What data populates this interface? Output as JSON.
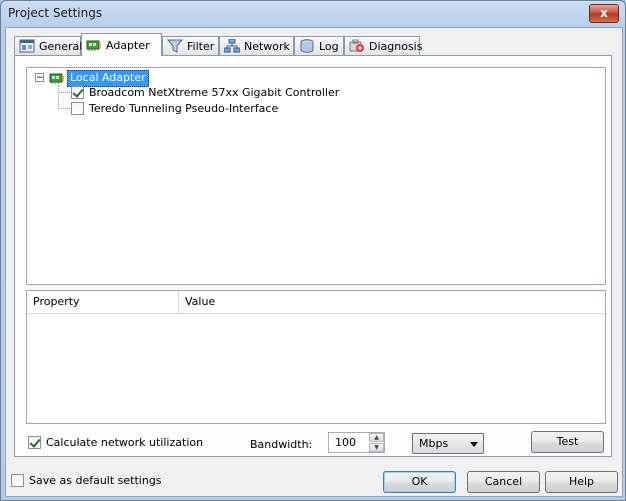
{
  "window": {
    "title": "Project Settings",
    "close_glyph": "x"
  },
  "tabs": [
    {
      "label": "General",
      "icon": "general-icon"
    },
    {
      "label": "Adapter",
      "icon": "adapter-icon",
      "active": true
    },
    {
      "label": "Filter",
      "icon": "filter-funnel-icon"
    },
    {
      "label": "Network",
      "icon": "network-icon"
    },
    {
      "label": "Log",
      "icon": "database-icon"
    },
    {
      "label": "Diagnosis",
      "icon": "diagnosis-icon"
    }
  ],
  "adapter": {
    "tree": {
      "root_label": "Local Adapter",
      "expander": "−",
      "items": [
        {
          "label": "Broadcom NetXtreme 57xx Gigabit Controller",
          "checked": true
        },
        {
          "label": "Teredo Tunneling Pseudo-Interface",
          "checked": false
        }
      ]
    },
    "grid": {
      "col_property": "Property",
      "col_value": "Value"
    },
    "calc_label": "Calculate network utilization",
    "calc_checked": true,
    "bandwidth_label": "Bandwidth:",
    "bandwidth_value": "100",
    "unit_value": "Mbps",
    "test_label": "Test"
  },
  "footer": {
    "save_default_label": "Save as default settings",
    "save_default_checked": false,
    "ok_label": "OK",
    "cancel_label": "Cancel",
    "help_label": "Help"
  },
  "colors": {
    "selection": "#3399ff",
    "accent_border": "#3c7fb1"
  }
}
